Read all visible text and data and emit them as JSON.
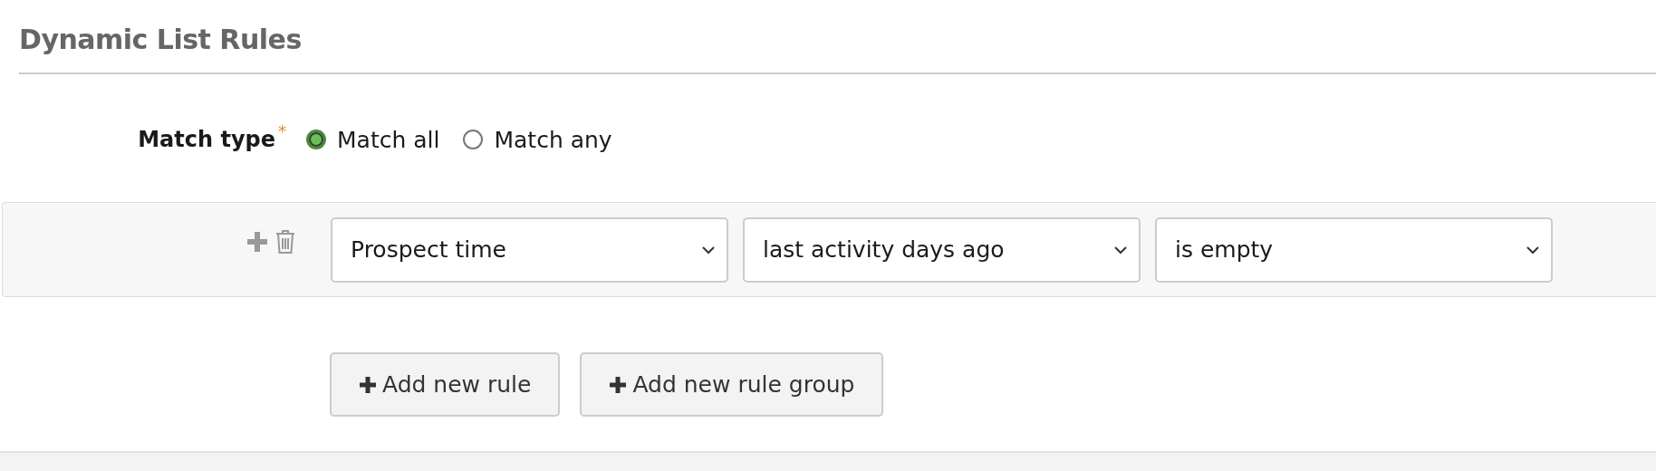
{
  "section": {
    "title": "Dynamic List Rules"
  },
  "match_type": {
    "label": "Match type",
    "required_mark": "*",
    "options": [
      {
        "label": "Match all",
        "selected": true
      },
      {
        "label": "Match any",
        "selected": false
      }
    ]
  },
  "rules": [
    {
      "fields": [
        "Prospect time",
        "last activity days ago",
        "is empty"
      ]
    }
  ],
  "buttons": [
    {
      "label": "Add new rule"
    },
    {
      "label": "Add new rule group"
    }
  ]
}
